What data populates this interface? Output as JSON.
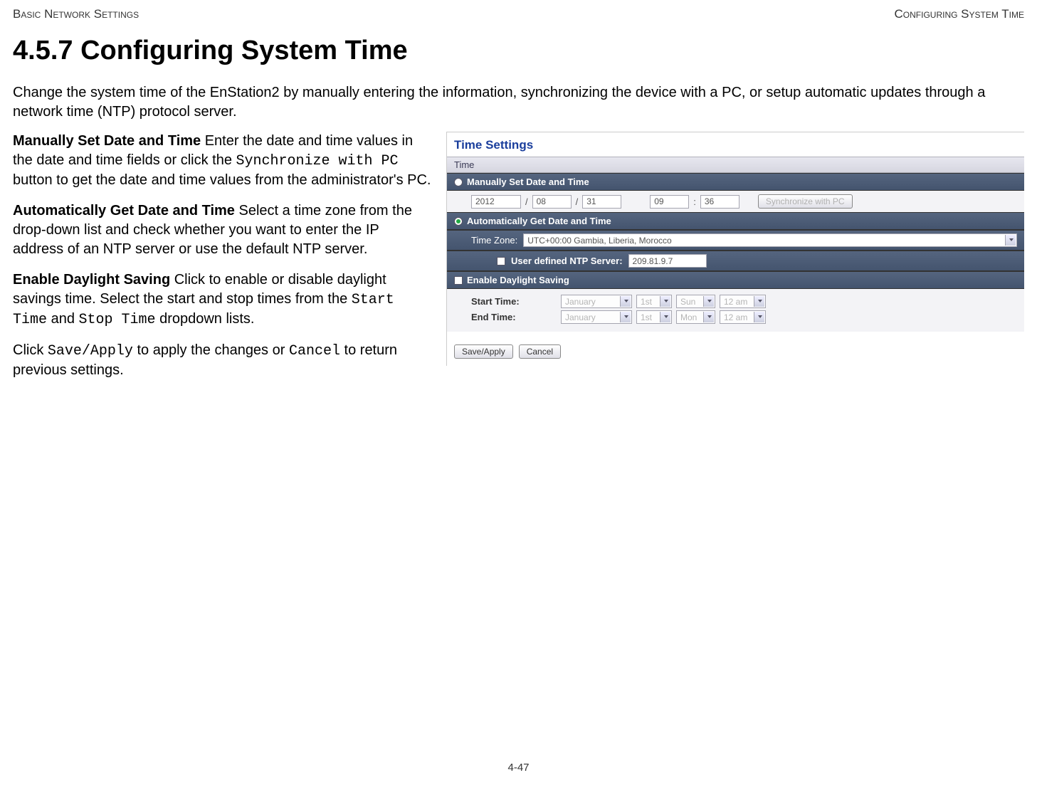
{
  "header": {
    "left": "Basic Network Settings",
    "right": "Configuring System Time"
  },
  "heading": "4.5.7 Configuring System Time",
  "intro": "Change the system time of the EnStation2 by manually entering the information, synchronizing the device with a PC, or setup automatic updates through a network time (NTP) protocol server.",
  "paragraphs": {
    "p1_bold": "Manually Set Date and Time",
    "p1_a": "  Enter the date and time values in the date and time fields or click the ",
    "p1_code": "Synchronize with PC",
    "p1_b": " button to get the date and time values from the administrator's PC.",
    "p2_bold": "Automatically Get Date and Time",
    "p2_a": "  Select a time zone from the drop-down list and check whether you want to enter the IP address of an NTP server or use the default NTP server.",
    "p3_bold": "Enable Daylight Saving",
    "p3_a": "  Click to enable or disable daylight savings time. Select the start and stop times from the ",
    "p3_code1": "Start Time",
    "p3_b": " and ",
    "p3_code2": "Stop Time",
    "p3_c": " dropdown lists.",
    "p4_a": "Click ",
    "p4_code1": "Save/Apply",
    "p4_b": " to apply the changes or ",
    "p4_code2": "Cancel",
    "p4_c": " to return previous settings."
  },
  "panel": {
    "title": "Time Settings",
    "time_section_label": "Time",
    "manual": {
      "label": "Manually Set Date and Time",
      "year": "2012",
      "month": "08",
      "day": "31",
      "hour": "09",
      "minute": "36",
      "sync_btn": "Synchronize with PC",
      "slash": "/",
      "colon": ":"
    },
    "auto": {
      "label": "Automatically Get Date and Time",
      "tz_label": "Time Zone:",
      "tz_value": "UTC+00:00 Gambia, Liberia, Morocco",
      "ntp_label": "User defined NTP Server:",
      "ntp_value": "209.81.9.7"
    },
    "dst": {
      "label": "Enable Daylight Saving",
      "start_label": "Start Time:",
      "end_label": "End Time:",
      "start": {
        "month": "January",
        "day": "1st",
        "weekday": "Sun",
        "time": "12 am"
      },
      "end": {
        "month": "January",
        "day": "1st",
        "weekday": "Mon",
        "time": "12 am"
      }
    },
    "buttons": {
      "save": "Save/Apply",
      "cancel": "Cancel"
    }
  },
  "page_number": "4-47"
}
